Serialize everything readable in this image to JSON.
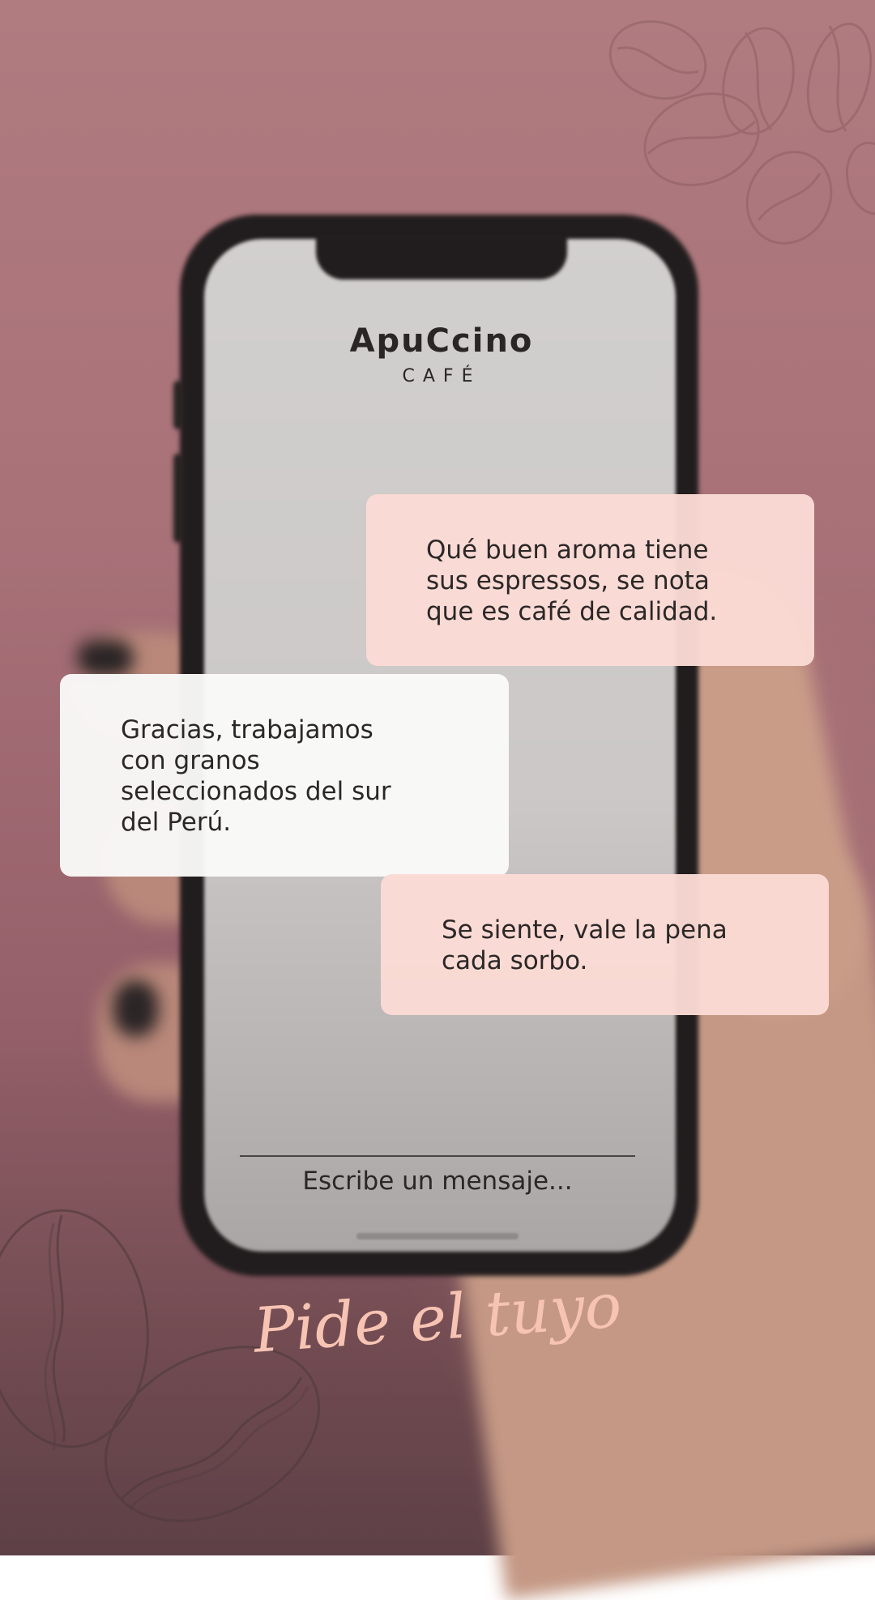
{
  "brand": {
    "name": "ApuCcino",
    "subtitle": "CAFÉ"
  },
  "messages": [
    {
      "sender": "customer",
      "text": "Qué buen aroma tiene\nsus espressos, se nota\nque es café de calidad."
    },
    {
      "sender": "cafe",
      "text": " Gracias, trabajamos\ncon granos\nseleccionados del sur\ndel Perú."
    },
    {
      "sender": "customer",
      "text": "Se siente, vale la pena\ncada sorbo."
    }
  ],
  "composer": {
    "placeholder": "Escribe un mensaje..."
  },
  "footer": {
    "cta": "Pide el tuyo"
  },
  "colors": {
    "background": "#a87178",
    "bubble_customer": "#fbdbd4",
    "bubble_cafe": "#fafaf9",
    "script_accent": "#f7c3b3",
    "text": "#2b2727"
  },
  "icons": [
    "coffee-bean-icon"
  ]
}
